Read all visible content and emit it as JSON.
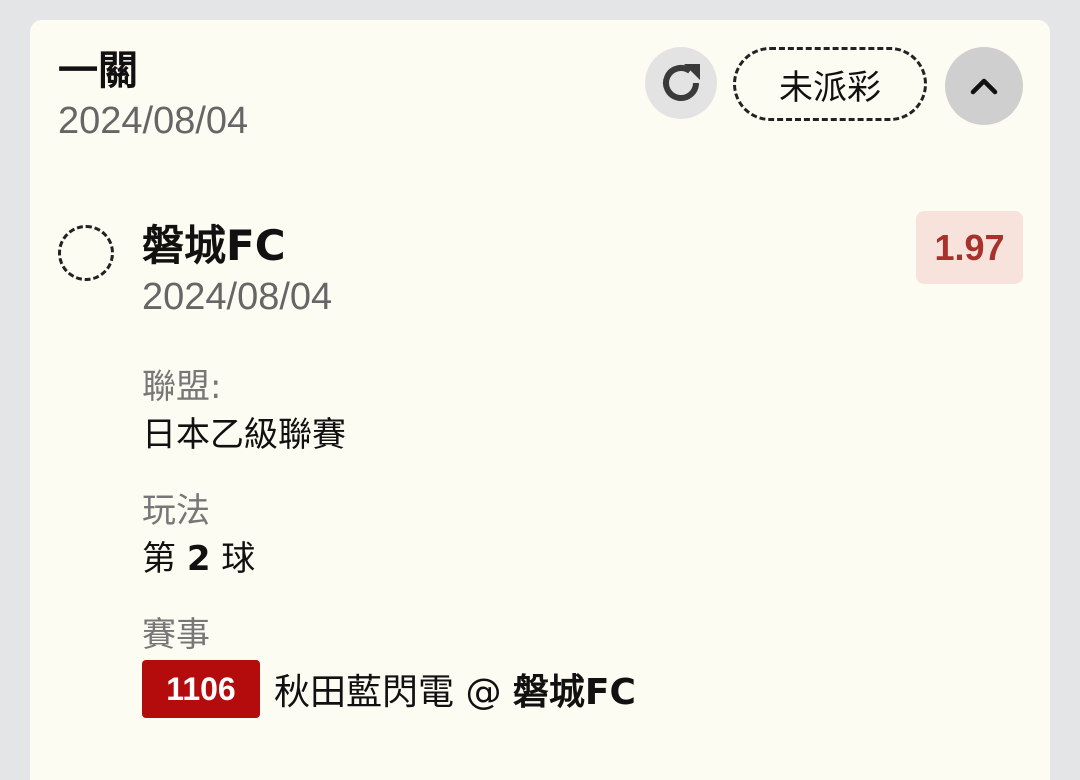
{
  "header": {
    "bet_type": "一關",
    "date": "2024/08/04",
    "status_label": "未派彩"
  },
  "icons": {
    "refresh": "refresh-icon",
    "collapse": "chevron-up-icon",
    "select": "dashed-circle-icon"
  },
  "selection": {
    "team": "磐城FC",
    "date": "2024/08/04",
    "odds": "1.97",
    "league_label": "聯盟:",
    "league_value": "日本乙級聯賽",
    "play_label": "玩法",
    "play_prefix": "第",
    "play_number": "2",
    "play_suffix": "球",
    "match_label": "賽事",
    "match_id": "1106",
    "match_away": "秋田藍閃電 @ ",
    "match_home": "磐城FC"
  },
  "colors": {
    "card_bg": "#fdfcf3",
    "odds_text": "#a8322b",
    "odds_bg": "#f8e3dc",
    "match_id_bg": "#b40c0c"
  }
}
